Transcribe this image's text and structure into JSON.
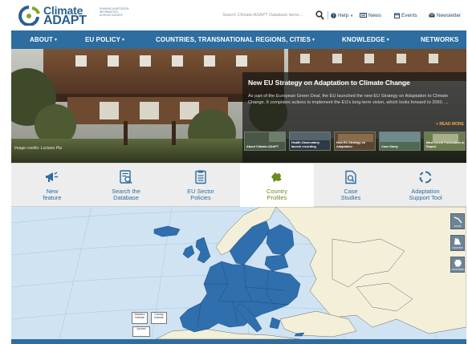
{
  "header": {
    "logo_word1": "Climate",
    "logo_word2": "ADAPT",
    "logo_tagline": [
      "Sharing adaptation",
      "information",
      "across Europe"
    ],
    "search_placeholder": "Search Climate-ADAPT Database items...",
    "help_label": "Help",
    "news_label": "News",
    "events_label": "Events",
    "newsletter_label": "Newsletter"
  },
  "nav": {
    "about": "ABOUT",
    "eu_policy": "EU POLICY",
    "countries": "COUNTRIES, TRANSNATIONAL REGIONS, CITIES",
    "knowledge": "KNOWLEDGE",
    "networks": "NETWORKS"
  },
  "hero": {
    "photo_credit": "Image credits: Luciano Pia",
    "feature_title": "New EU Strategy on Adaptation to Climate Change",
    "feature_text": "As part of the European Green Deal, the EU launched the new EU Strategy on Adaptation to Climate Change. It comprises actions to implement the EU's long-term vision, which looks forward to 2050. ...",
    "read_more": "+ READ MORE",
    "thumbs": [
      {
        "label": "About Climate-ADAPT"
      },
      {
        "label": "Health Observatory launch recording"
      },
      {
        "label": "New EU Strategy on Adaptation"
      },
      {
        "label": "Case Study"
      },
      {
        "label": "Most recent Publication or Report"
      }
    ]
  },
  "quicklinks": [
    {
      "line1": "New",
      "line2": "feature"
    },
    {
      "line1": "Search the",
      "line2": "Database"
    },
    {
      "line1": "EU Sector",
      "line2": "Policies"
    },
    {
      "line1": "Country",
      "line2": "Profiles"
    },
    {
      "line1": "Case",
      "line2": "Studies"
    },
    {
      "line1": "Adaptation",
      "line2": "Support Tool"
    }
  ],
  "map": {
    "inset_azores": "Azores",
    "inset_madeira": "Madeira Islands",
    "inset_canary": "Canary Islands",
    "tools": [
      "ZOOM",
      "COUNTRY",
      "ALL COUNTRIES"
    ]
  },
  "colors": {
    "brand_blue": "#2d6d9f",
    "member_state_blue": "#2f6fae",
    "other_land": "#f4efd9",
    "sea": "#cfe3f3",
    "active_quicklink": "#6b8b1e",
    "read_more": "#f0a64a"
  }
}
